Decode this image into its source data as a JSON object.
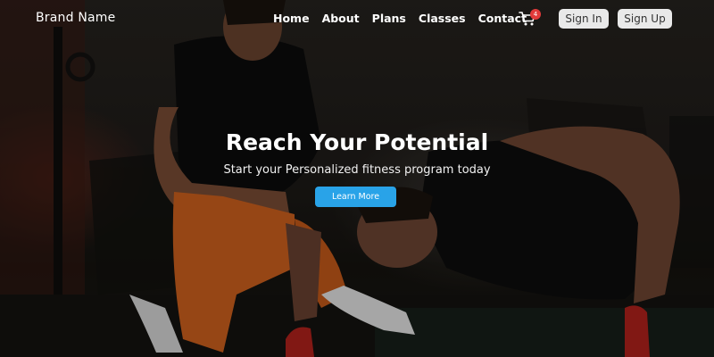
{
  "navbar": {
    "brand": "Brand Name",
    "links": [
      "Home",
      "About",
      "Plans",
      "Classes",
      "Contact"
    ],
    "cart": {
      "icon": "cart-icon",
      "count": "4"
    },
    "sign_in": "Sign In",
    "sign_up": "Sign Up"
  },
  "hero": {
    "title": "Reach Your Potential",
    "subtitle": "Start your Personalized fitness program today",
    "cta_label": "Learn More"
  },
  "colors": {
    "cta": "#29a3e8",
    "badge": "#e23a3a",
    "auth_button": "#e9e9e9"
  }
}
